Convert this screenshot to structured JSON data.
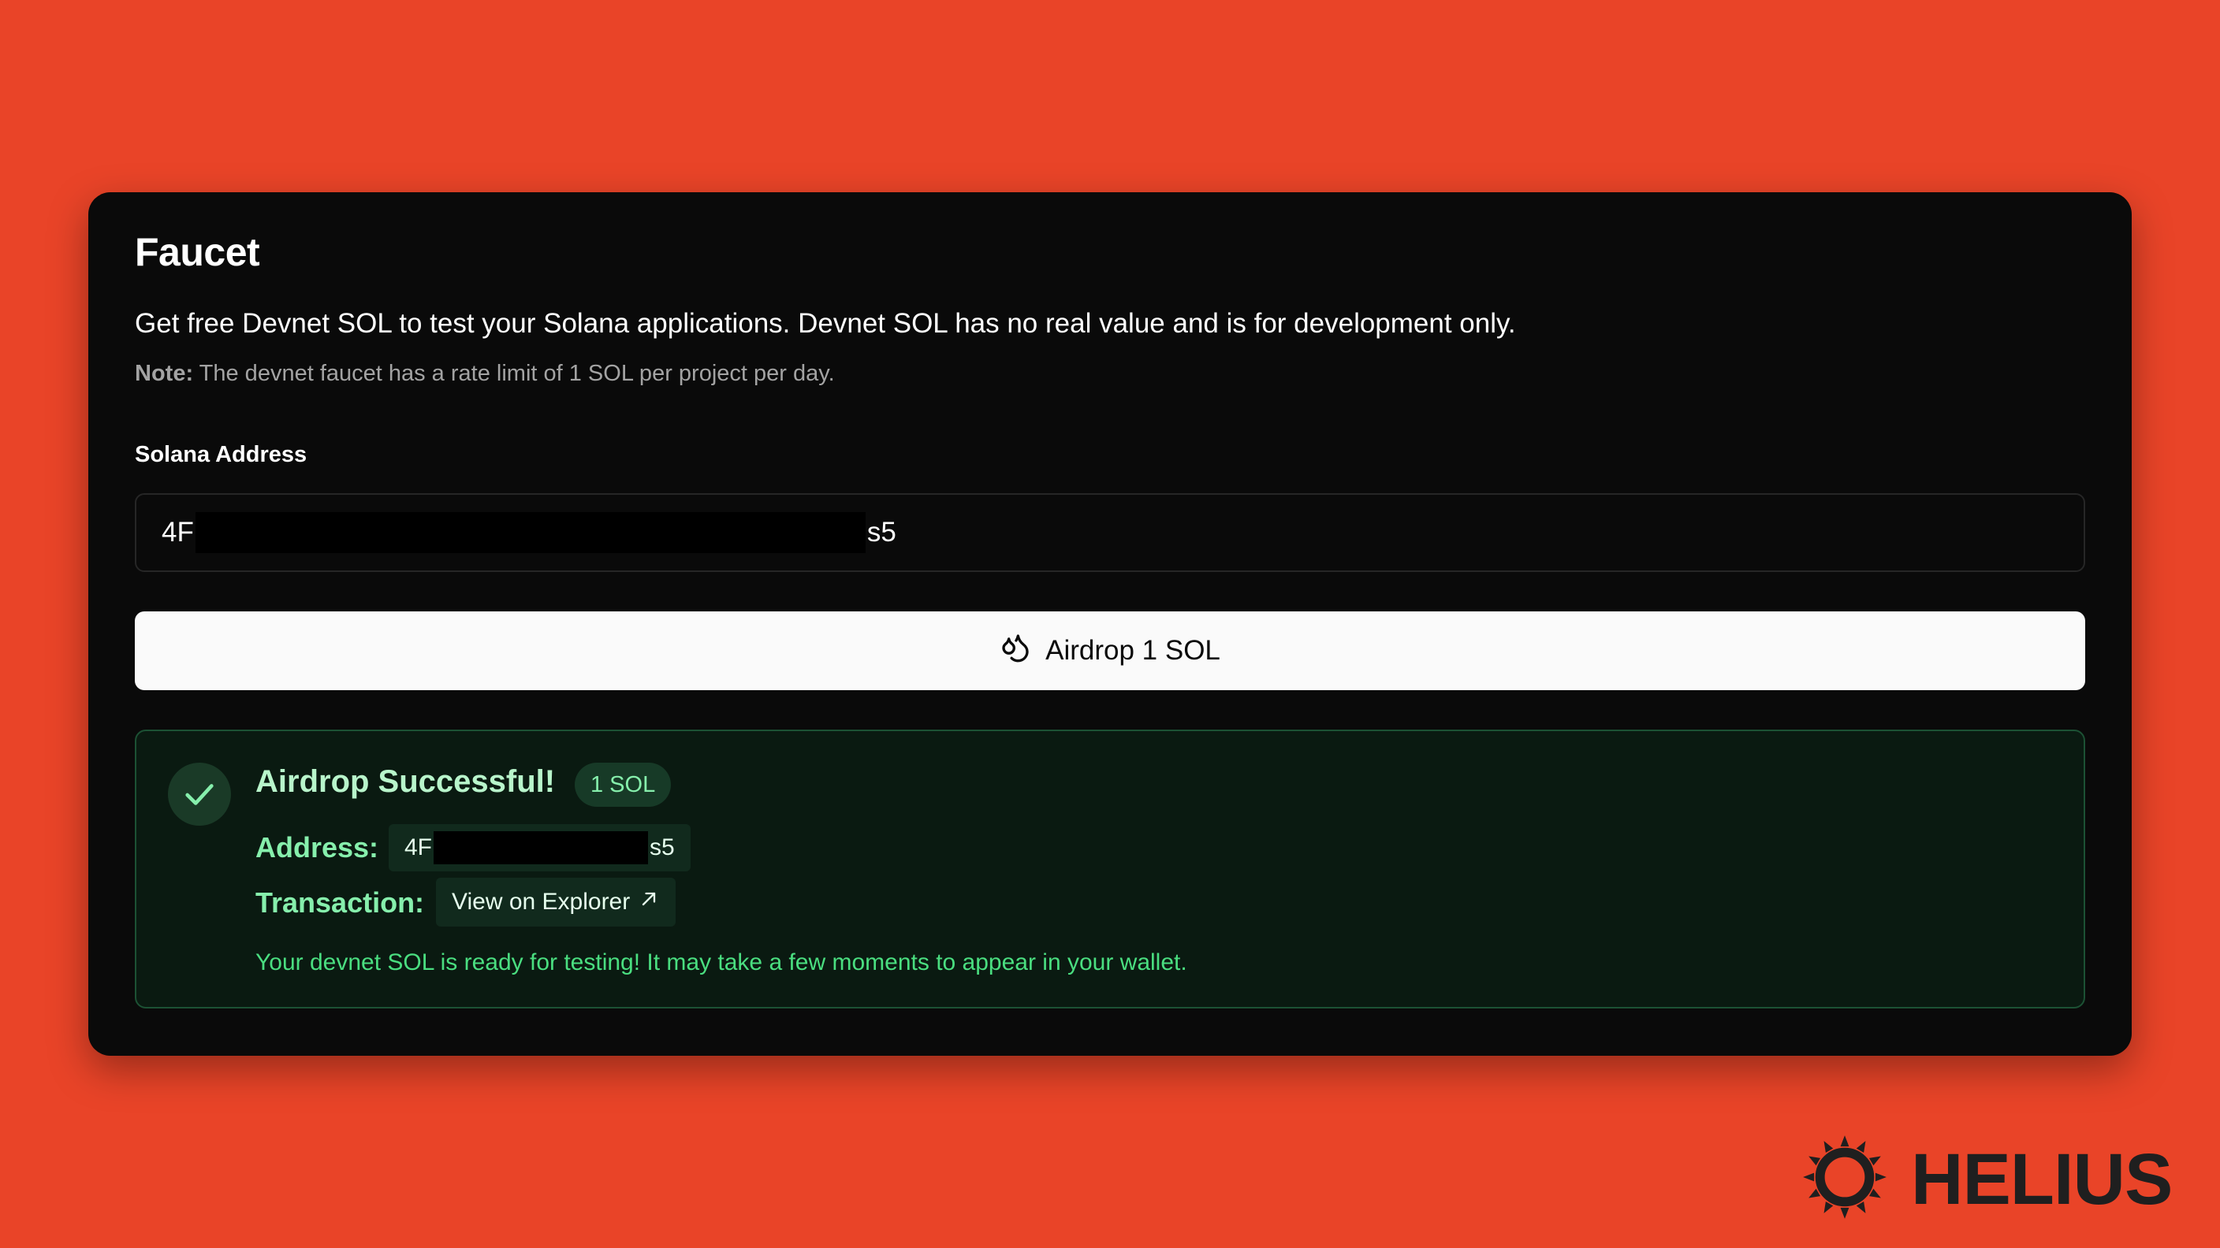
{
  "faucet": {
    "title": "Faucet",
    "description": "Get free Devnet SOL to test your Solana applications. Devnet SOL has no real value and is for development only.",
    "note_label": "Note:",
    "note_text": "The devnet faucet has a rate limit of 1 SOL per project per day.",
    "address_label": "Solana Address",
    "address_prefix": "4F",
    "address_suffix": "s5",
    "airdrop_button_label": "Airdrop 1 SOL",
    "airdrop_button_icon": "droplets-icon"
  },
  "success": {
    "icon": "check-icon",
    "title": "Airdrop Successful!",
    "badge": "1 SOL",
    "address_label": "Address:",
    "address_prefix": "4F",
    "address_suffix": "s5",
    "transaction_label": "Transaction:",
    "explorer_link": "View on Explorer",
    "explorer_icon": "external-link-icon",
    "ready_message": "Your devnet SOL is ready for testing! It may take a few moments to appear in your wallet."
  },
  "brand": {
    "name": "HELIUS",
    "logo_icon": "helius-sun-logo"
  },
  "colors": {
    "background": "#E94428",
    "card": "#0A0A0A",
    "success_bg": "#0A1A11",
    "success_border": "#1C5134",
    "success_text": "#4ADE80",
    "button_bg": "#FAFAFA"
  }
}
